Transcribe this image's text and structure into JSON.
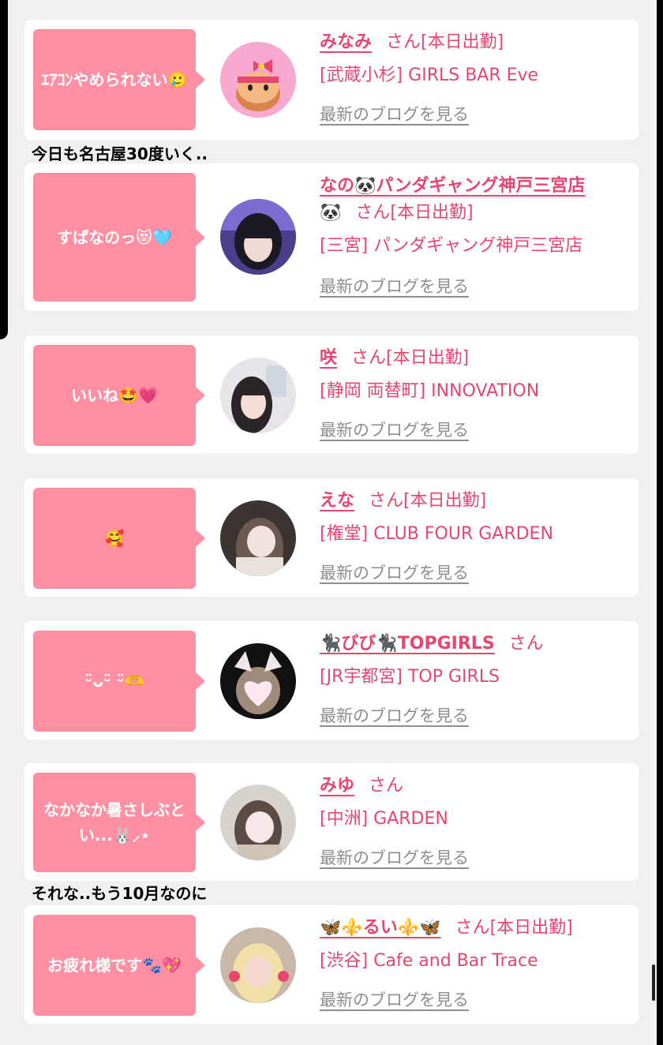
{
  "colors": {
    "accent": "#e8456f",
    "bubble": "#ff8fa3",
    "link_gray": "#8e8e8e"
  },
  "blog_link": "最新のブログを見る",
  "captions": [
    "今日も名古屋30度いく..",
    "それな..もう10月なのに"
  ],
  "entries": [
    {
      "message": "ｴｱｺﾝやめられない🥲",
      "name": "みなみ",
      "suffix": "さん[本日出勤]",
      "shop": "[武蔵小杉] GIRLS BAR Eve",
      "avatar": "hello-kitty-avatar"
    },
    {
      "message": "すぱなのっ😻🩵",
      "name": "なの🐼パンダギャング神戸三宮店",
      "suffix": "さん[本日出勤]",
      "name_extra": "🐼",
      "shop": "[三宮] パンダギャング神戸三宮店",
      "avatar": "girl-photo-avatar"
    },
    {
      "message": "いいね🤩💗",
      "name": "咲",
      "suffix": "さん[本日出勤]",
      "shop": "[静岡 両替町] INNOVATION",
      "avatar": "girl-photo-avatar"
    },
    {
      "message": "🥰",
      "name": "えな",
      "suffix": "さん[本日出勤]",
      "shop": "[権堂] CLUB FOUR GARDEN",
      "avatar": "girl-photo-avatar"
    },
    {
      "message": "ᵕ̈ᴗᵕ̈ ᵕ̈🫶",
      "name": "🐈‍⬛びび🐈‍⬛TOPGIRLS",
      "suffix": "さん",
      "shop": "[JR宇都宮] TOP GIRLS",
      "avatar": "cat-ear-avatar"
    },
    {
      "message": "なかなか暑さしぶとい...🐰⸝⋆",
      "name": "みゆ",
      "suffix": "さん",
      "shop": "[中洲] GARDEN",
      "avatar": "girl-photo-avatar"
    },
    {
      "message": "お疲れ様です🐾💖",
      "name": "🦋⚜️るい⚜️🦋",
      "suffix": "さん[本日出勤]",
      "shop": "[渋谷] Cafe and Bar Trace",
      "avatar": "blonde-girl-avatar"
    }
  ]
}
